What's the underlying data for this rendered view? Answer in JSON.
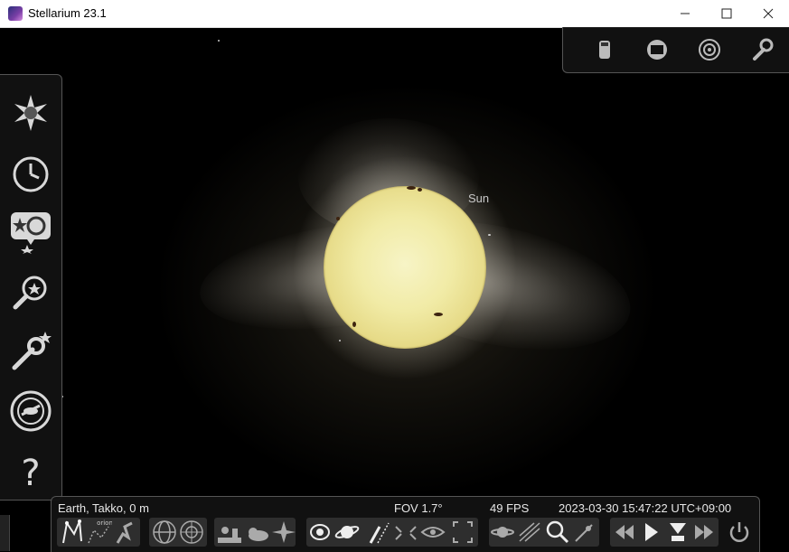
{
  "window": {
    "title": "Stellarium 23.1",
    "minimize_label": "—",
    "maximize_label": "☐",
    "close_label": "✕"
  },
  "sky": {
    "object_label": "Sun"
  },
  "status": {
    "location": "Earth, Takko, 0 m",
    "fov": "FOV 1.7°",
    "fps": "49 FPS",
    "datetime": "2023-03-30 15:47:22 UTC+09:00"
  },
  "icons": {
    "top": [
      "telescope-icon",
      "screen-icon",
      "target-icon",
      "wrench-icon"
    ],
    "left": [
      "sky-and-viewing-options-icon",
      "date-time-icon",
      "location-icon",
      "search-icon",
      "configuration-icon",
      "ocular-icon",
      "help-icon"
    ],
    "bottom": [
      "constellation-lines-icon",
      "constellation-labels-icon",
      "constellation-art-icon",
      "equatorial-grid-icon",
      "azimuthal-grid-icon",
      "ground-icon",
      "cardinal-points-icon",
      "atmosphere-icon",
      "nebulae-icon",
      "planet-labels-icon",
      "meteor-showers-icon",
      "satellites-icon",
      "eye-icon",
      "fullscreen-icon",
      "planets-hints-icon",
      "exoplanets-icon",
      "search-object-icon",
      "compass-icon",
      "rewind-icon",
      "play-icon",
      "time-now-icon",
      "fast-forward-icon",
      "quit-icon"
    ]
  },
  "bottom_labels": {
    "constellation_labels_tag": "orion"
  },
  "colors": {
    "panel": "#121212",
    "panel_border": "#555555",
    "icon": "#d8d8d8",
    "sun": "#f1eba6"
  }
}
